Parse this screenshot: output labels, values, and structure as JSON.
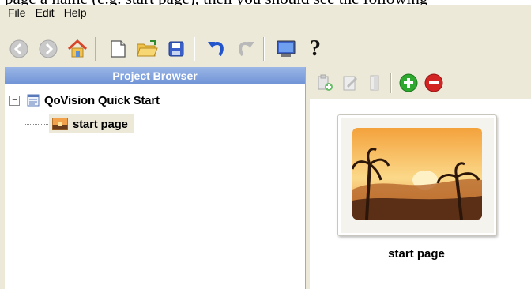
{
  "doc_overflow_text": "page a name (e.g. start page), then you should see the following",
  "menu": {
    "file": "File",
    "edit": "Edit",
    "help": "Help"
  },
  "toolbar": {
    "icons": [
      "back-icon",
      "forward-icon",
      "home-icon",
      "new-page-icon",
      "open-folder-icon",
      "save-icon",
      "undo-icon",
      "redo-icon",
      "preview-monitor-icon",
      "help-question-icon"
    ],
    "help_glyph": "?"
  },
  "project_browser": {
    "title": "Project Browser",
    "root": {
      "label": "QoVision Quick Start",
      "expander": "−"
    },
    "child": {
      "label": "start page"
    }
  },
  "page_panel": {
    "toolbar_icons": [
      "paste-page-icon",
      "edit-page-icon",
      "copy-page-icon",
      "add-page-icon",
      "remove-page-icon"
    ],
    "thumbnail": {
      "label": "start page",
      "image": "sunset-landscape"
    }
  },
  "colors": {
    "window_bg": "#ece9d8",
    "panel_header_top": "#9bb6e6",
    "panel_header_bottom": "#6f93d6",
    "add_green": "#2ea82e",
    "remove_red": "#d32424",
    "undo_blue": "#2255cc"
  }
}
